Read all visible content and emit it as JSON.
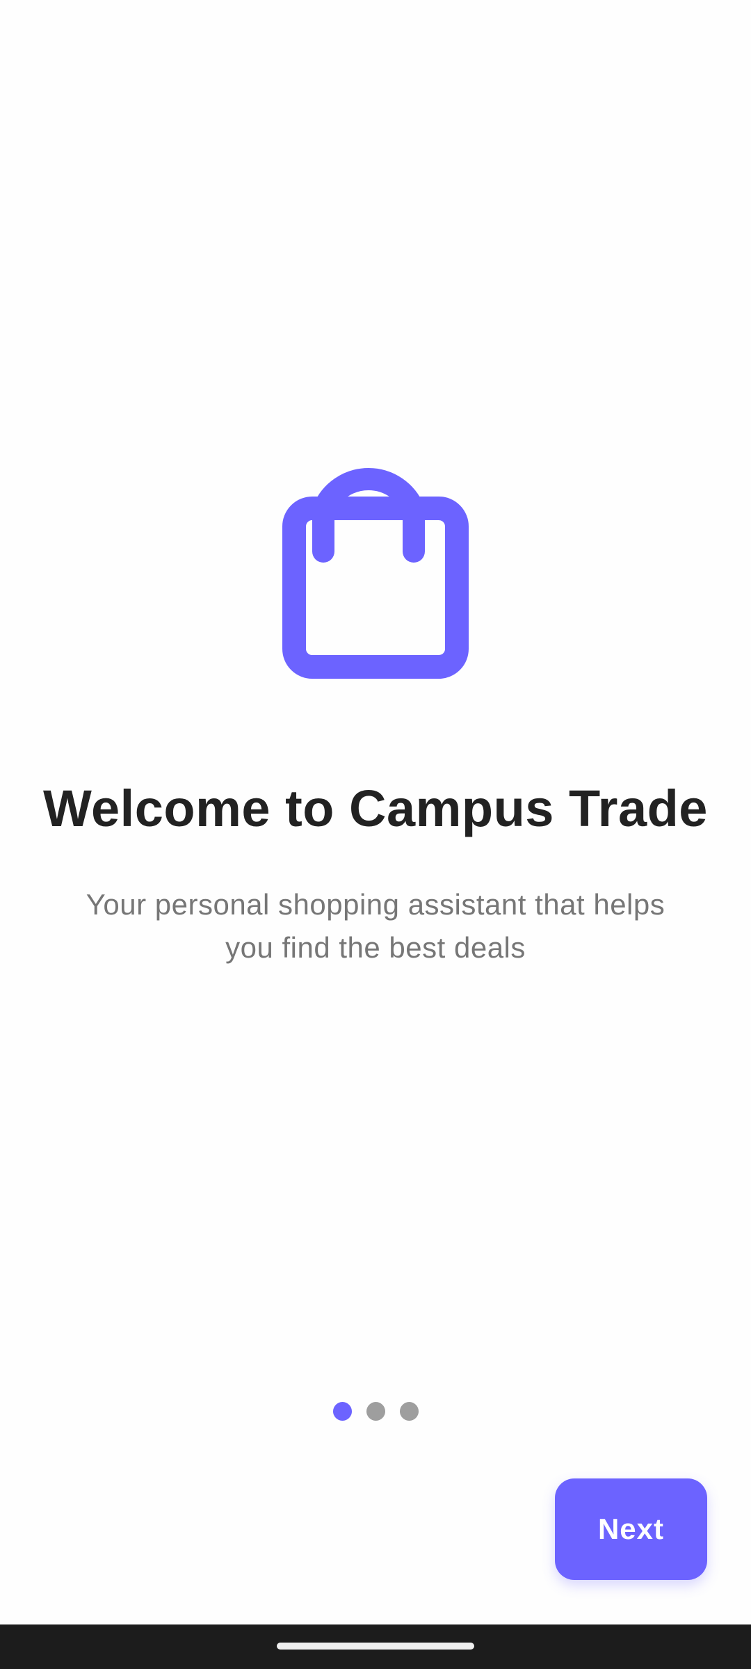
{
  "onboarding": {
    "icon": "shopping-bag-icon",
    "title": "Welcome to Campus Trade",
    "subtitle": "Your personal shopping assistant that helps you find the best deals",
    "pages_total": 3,
    "current_page": 1,
    "next_label": "Next"
  },
  "colors": {
    "accent": "#6c63ff",
    "title": "#222222",
    "subtitle": "#767676",
    "dot_inactive": "#9e9e9e",
    "nav_bar": "#1c1c1c"
  }
}
